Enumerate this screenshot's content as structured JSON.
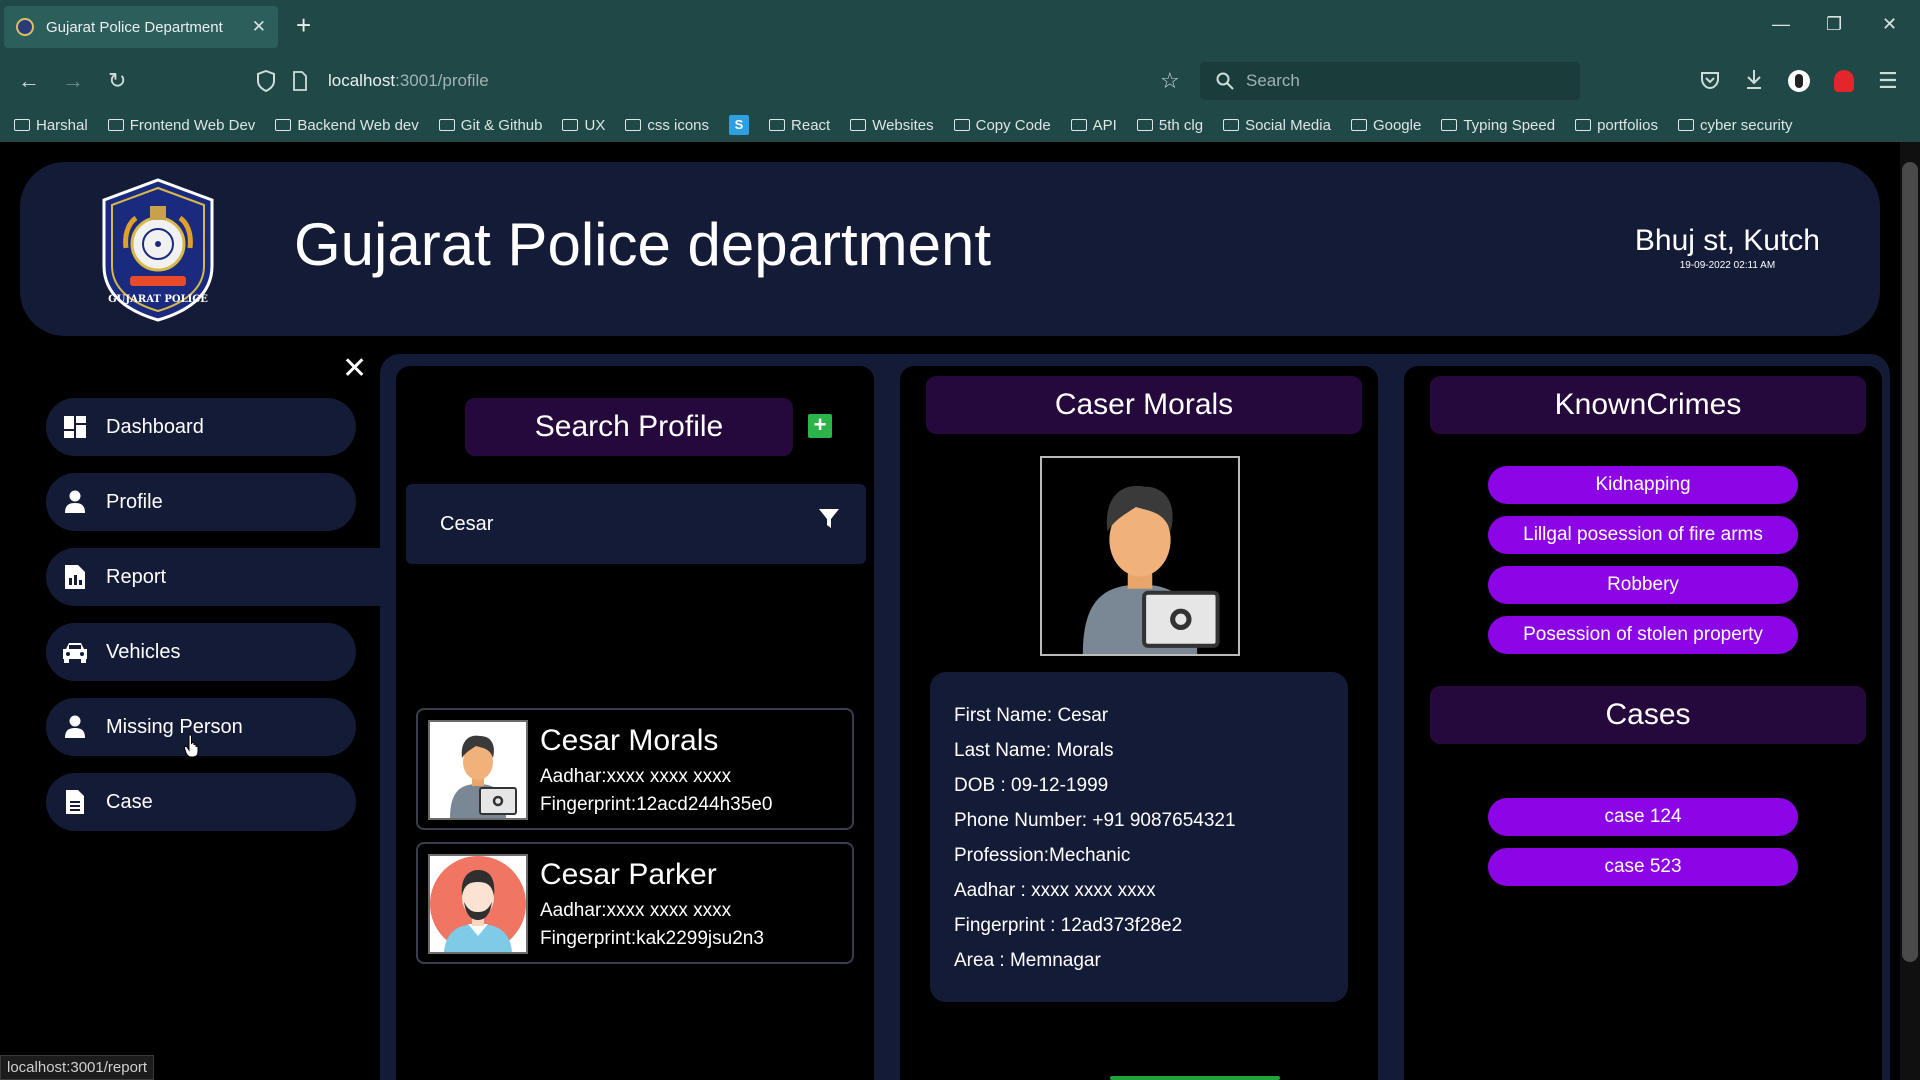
{
  "browser": {
    "tab_title": "Gujarat Police Department",
    "url_host": "localhost",
    "url_path": ":3001/profile",
    "search_placeholder": "Search",
    "status_url": "localhost:3001/report",
    "bookmarks": [
      "Harshal",
      "Frontend Web Dev",
      "Backend Web dev",
      "Git & Github",
      "UX",
      "css icons",
      "S",
      "React",
      "Websites",
      "Copy Code",
      "API",
      "5th clg",
      "Social Media",
      "Google",
      "Typing Speed",
      "portfolios",
      "cyber security"
    ]
  },
  "header": {
    "title": "Gujarat Police department",
    "location": "Bhuj st, Kutch",
    "datetime": "19-09-2022 02:11 AM",
    "logo_text": "GUJARAT POLICE"
  },
  "sidebar": {
    "items": [
      {
        "label": "Dashboard",
        "icon": "dashboard-icon"
      },
      {
        "label": "Profile",
        "icon": "user-icon"
      },
      {
        "label": "Report",
        "icon": "report-icon"
      },
      {
        "label": "Vehicles",
        "icon": "car-icon"
      },
      {
        "label": "Missing Person",
        "icon": "user-icon"
      },
      {
        "label": "Case",
        "icon": "document-icon"
      }
    ],
    "active": "Report"
  },
  "search": {
    "title": "Search Profile",
    "add_label": "+",
    "query": "Cesar",
    "results": [
      {
        "name": "Cesar Morals",
        "aadhar": "Aadhar:xxxx xxxx xxxx",
        "fingerprint": "Fingerprint:12acd244h35e0"
      },
      {
        "name": "Cesar Parker",
        "aadhar": "Aadhar:xxxx xxxx xxxx",
        "fingerprint": "Fingerprint:kak2299jsu2n3"
      }
    ]
  },
  "profile": {
    "title": "Caser Morals",
    "details": [
      "First Name: Cesar",
      "Last Name: Morals",
      "DOB : 09-12-1999",
      "Phone Number: +91 9087654321",
      "Profession:Mechanic",
      "Aadhar : xxxx xxxx xxxx",
      "Fingerprint : 12ad373f28e2",
      "Area : Memnagar"
    ]
  },
  "crimes": {
    "title": "KnownCrimes",
    "items": [
      "Kidnapping",
      "Lillgal posession of fire arms",
      "Robbery",
      "Posession of stolen property"
    ],
    "cases_title": "Cases",
    "cases": [
      "case 124",
      "case 523"
    ]
  },
  "colors": {
    "accent": "#8b05e6",
    "header_bg": "#141b37",
    "title_bg": "#25093d",
    "chrome": "#1f4846"
  }
}
